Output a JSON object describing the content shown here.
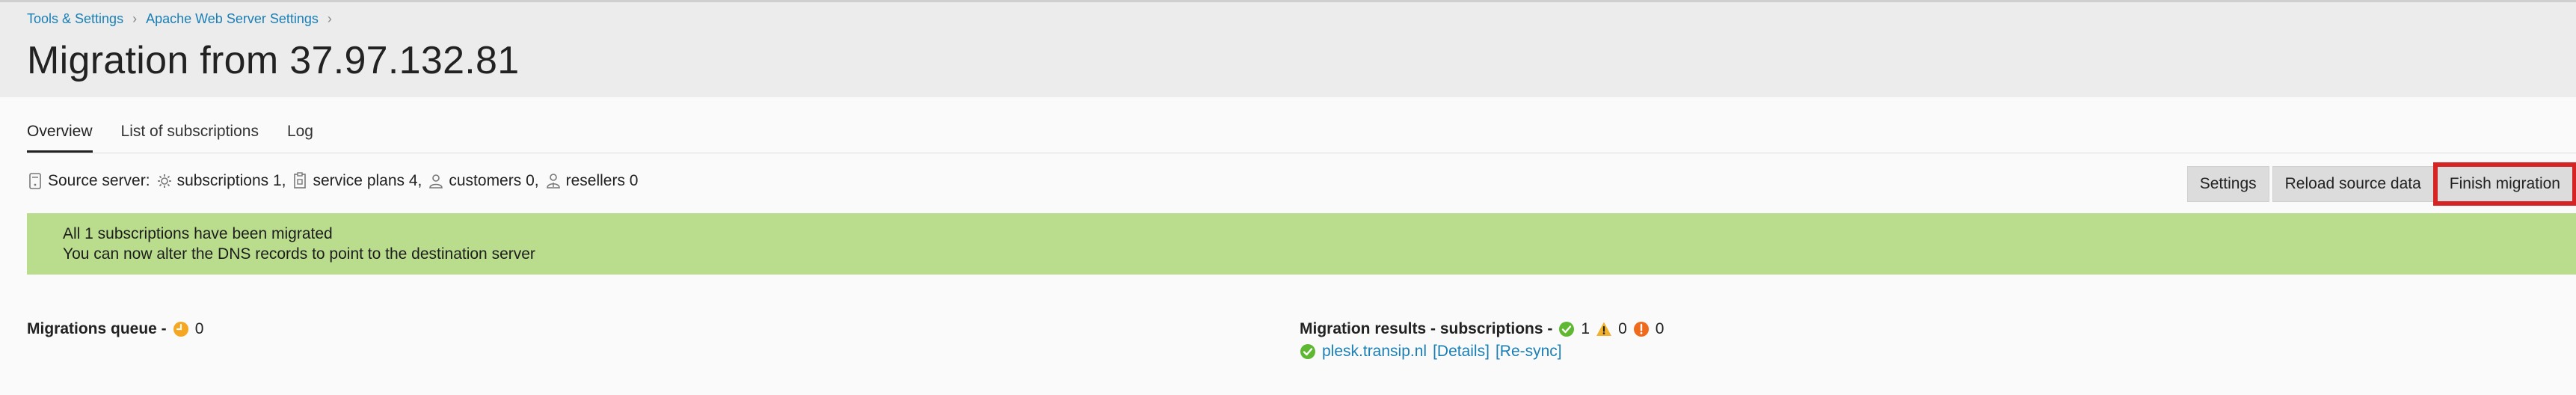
{
  "breadcrumb": {
    "items": [
      "Tools & Settings",
      "Apache Web Server Settings"
    ],
    "separator": "›"
  },
  "page_title": "Migration from 37.97.132.81",
  "tabs": [
    {
      "label": "Overview",
      "active": true
    },
    {
      "label": "List of subscriptions",
      "active": false
    },
    {
      "label": "Log",
      "active": false
    }
  ],
  "source": {
    "label": "Source server:",
    "subscriptions": "subscriptions 1,",
    "service_plans": "service plans 4,",
    "customers": "customers 0,",
    "resellers": "resellers 0"
  },
  "toolbar": {
    "settings_label": "Settings",
    "reload_label": "Reload source data",
    "finish_label": "Finish migration"
  },
  "message": {
    "line1": "All 1 subscriptions have been migrated",
    "line2": "You can now alter the DNS records to point to the destination server"
  },
  "queue": {
    "label": "Migrations queue -",
    "count": "0"
  },
  "results": {
    "label": "Migration results - subscriptions -",
    "success": "1",
    "warning": "0",
    "error": "0",
    "item": {
      "name": "plesk.transip.nl",
      "details": "[Details]",
      "resync": "[Re-sync]"
    }
  },
  "colors": {
    "link": "#1a7fb5",
    "success_bg": "#b9dd8d",
    "highlight": "#d62424",
    "ok_icon": "#5fb832",
    "warn_icon": "#f2b12c",
    "err_icon": "#ef6a1d",
    "clock_icon": "#f5a623"
  }
}
